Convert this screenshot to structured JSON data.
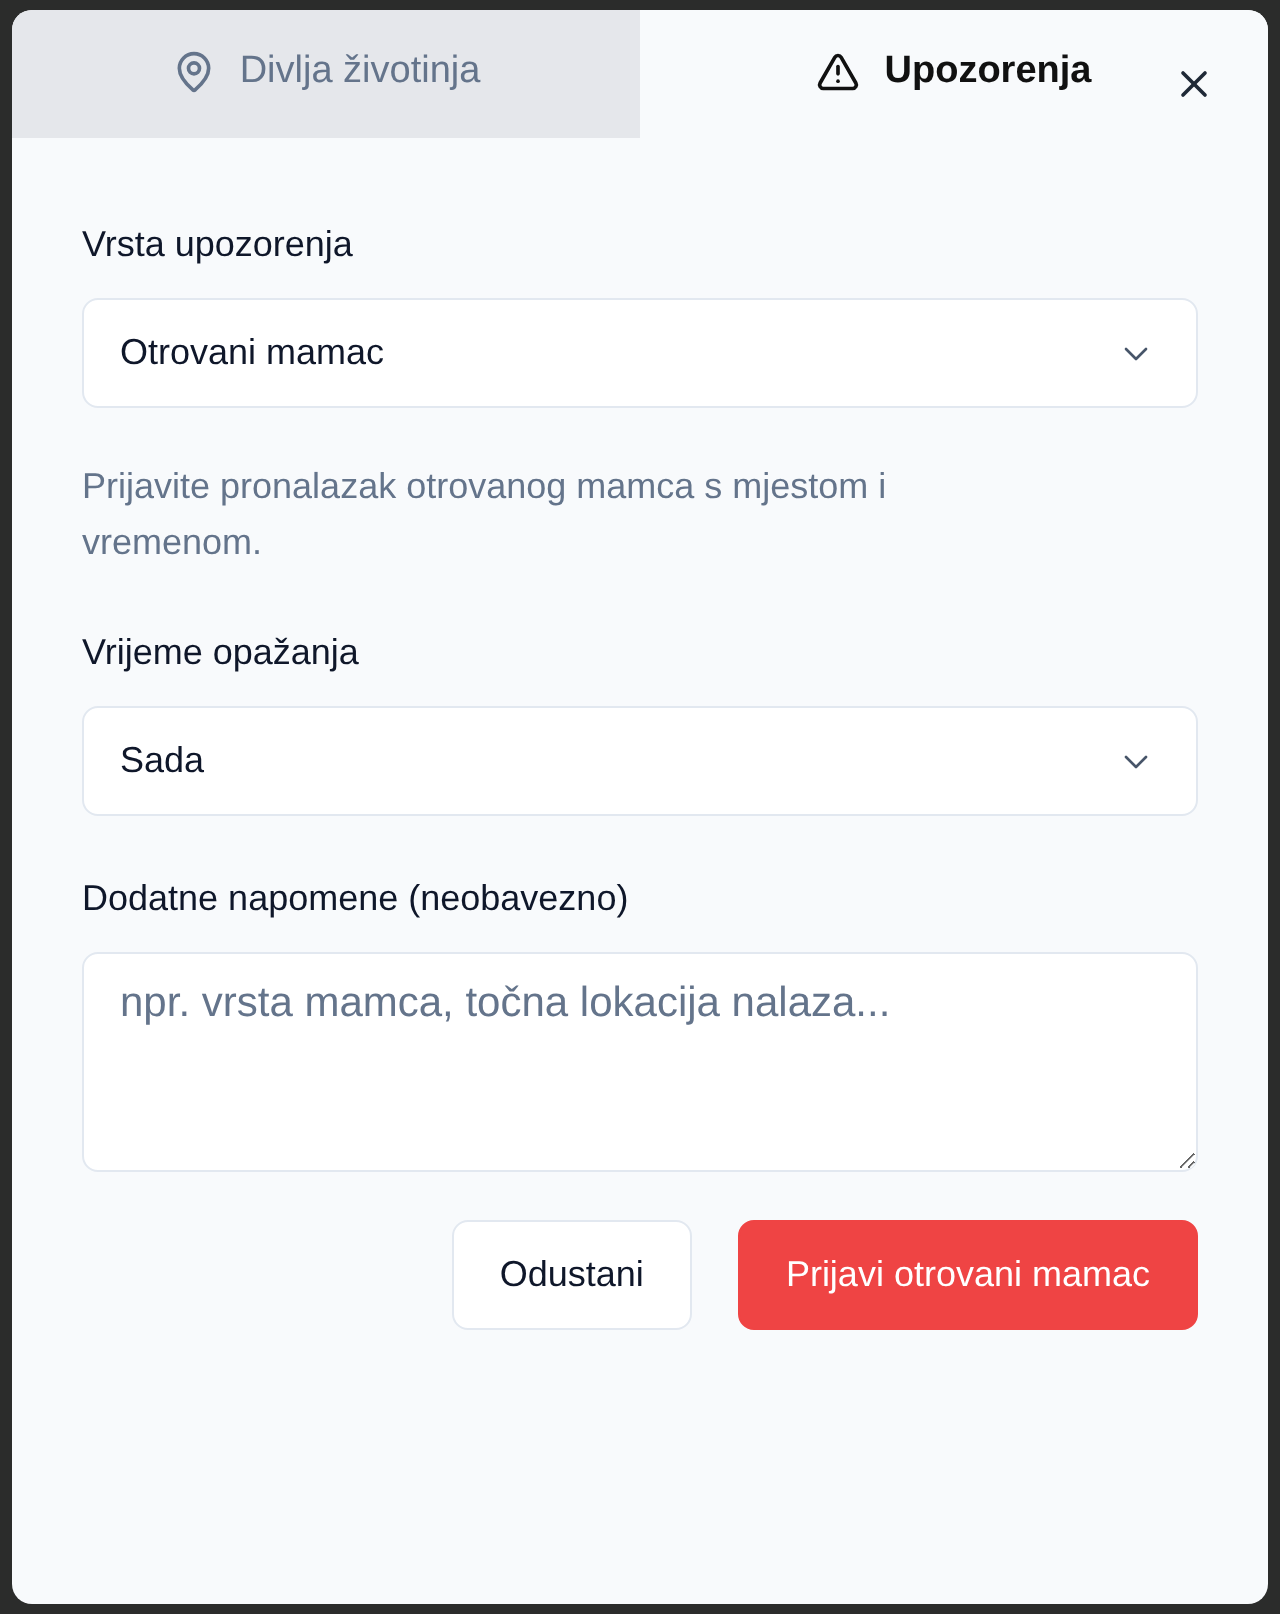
{
  "tabs": [
    {
      "label": "Divlja životinja",
      "selected": false
    },
    {
      "label": "Upozorenja",
      "selected": true
    }
  ],
  "fields": [
    {
      "kind": "select",
      "label": "Vrsta upozorenja",
      "value": "Otrovani mamac",
      "help": "Prijavite pronalazak otrovanog mamca s mjestom i vremenom."
    },
    {
      "kind": "select",
      "label": "Vrijeme opažanja",
      "value": "Sada"
    },
    {
      "kind": "textarea",
      "label": "Dodatne napomene (neobavezno)",
      "placeholder": "npr. vrsta mamca, točna lokacija nalaza..."
    }
  ],
  "buttons": [
    {
      "kind": "secondary",
      "label": "Odustani"
    },
    {
      "kind": "primary",
      "label": "Prijavi otrovani mamac"
    }
  ]
}
